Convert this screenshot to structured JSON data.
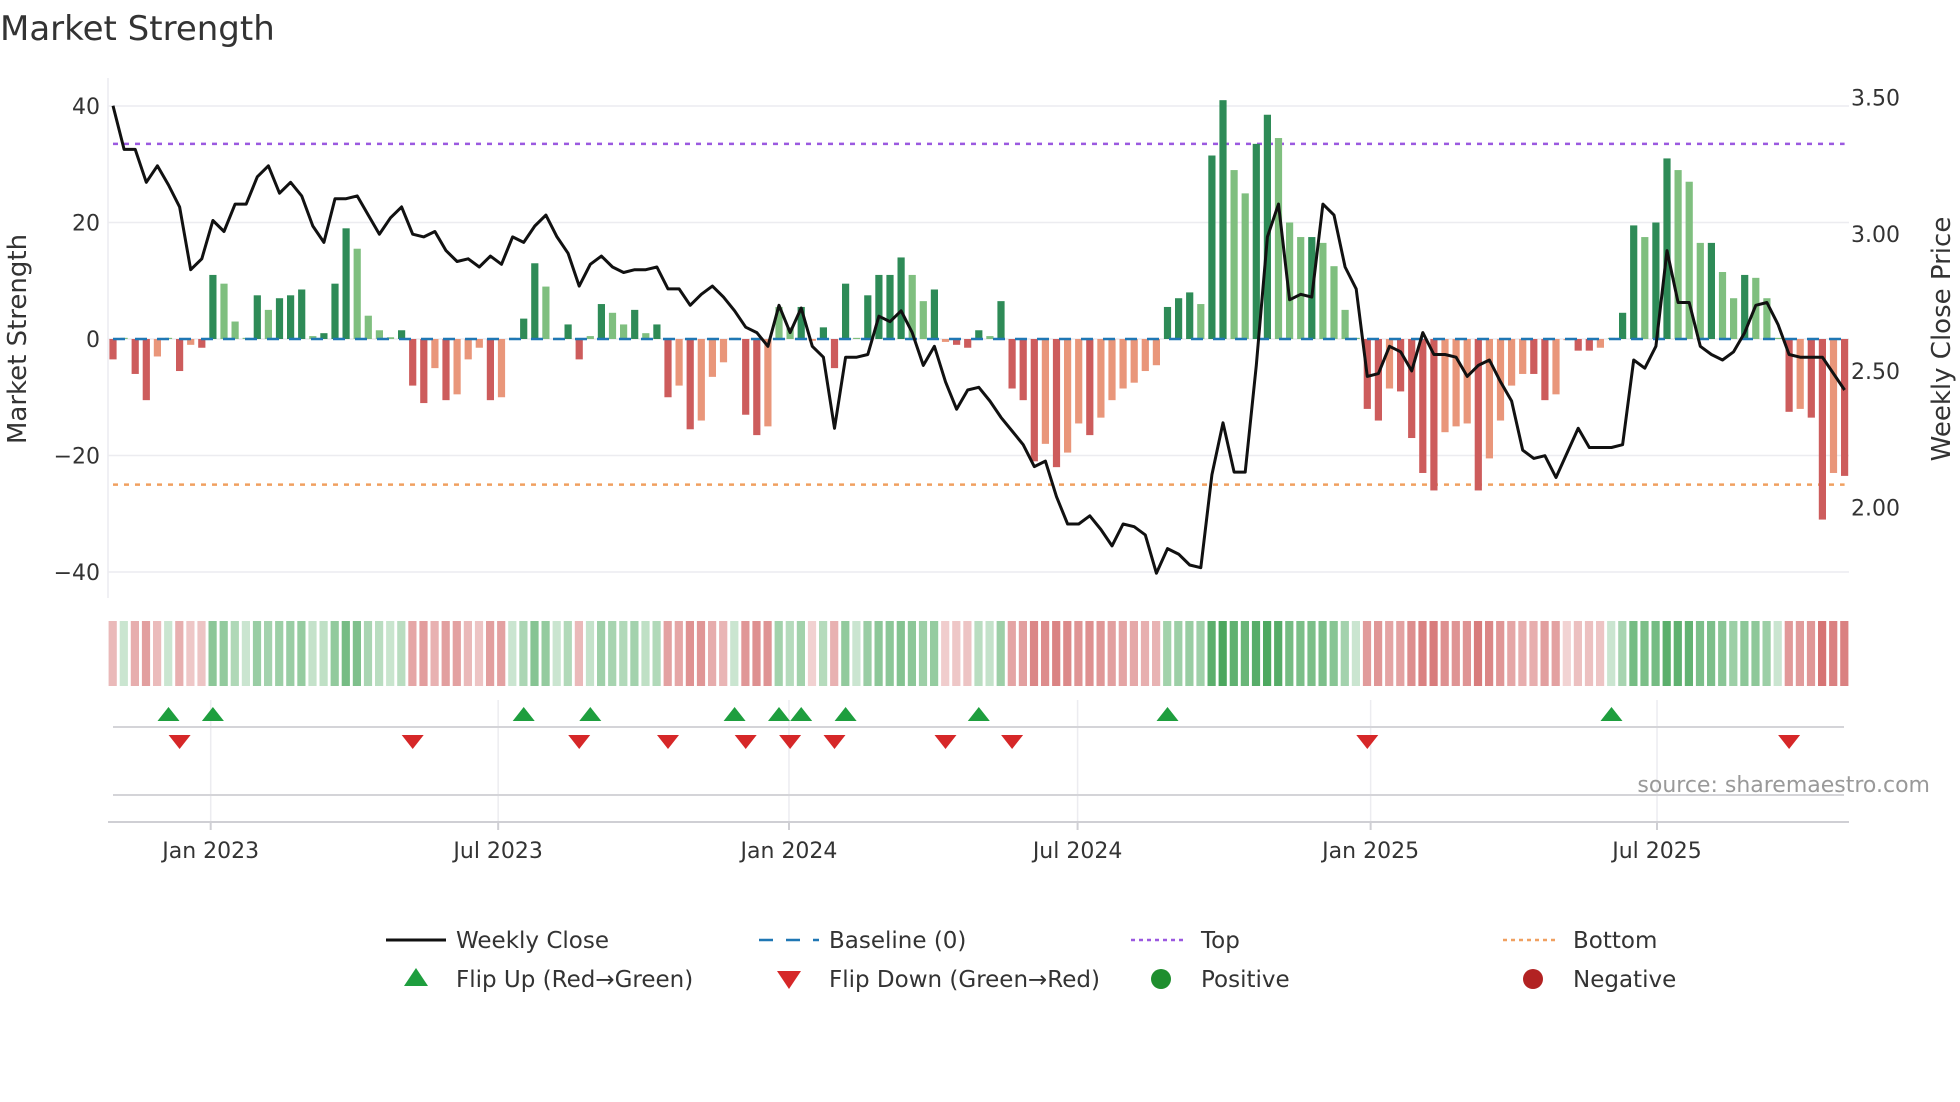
{
  "chart_data": {
    "type": "bar",
    "title": "Market Strength",
    "ylabel": "Market Strength",
    "y2label": "Weekly Close Price",
    "ylim": [
      -45,
      45
    ],
    "y2lim": [
      1.75,
      3.55
    ],
    "yticks": [
      40,
      20,
      0,
      -20,
      -40
    ],
    "ytick_labels": [
      "40",
      "20",
      "0",
      "−20",
      "−40"
    ],
    "y2ticks": [
      3.5,
      3.0,
      2.5,
      2.0
    ],
    "y2tick_labels": [
      "3.50",
      "3.00",
      "2.50",
      "2.00"
    ],
    "start_date": "2022-11-04",
    "frequency": "weekly",
    "xticks": [
      {
        "label": "Jan 2023",
        "week": 8.8
      },
      {
        "label": "Jul 2023",
        "week": 34.7
      },
      {
        "label": "Jan 2024",
        "week": 60.9
      },
      {
        "label": "Jul 2024",
        "week": 86.9
      },
      {
        "label": "Jan 2025",
        "week": 113.3
      },
      {
        "label": "Jul 2025",
        "week": 139.1
      }
    ],
    "top_level": 33.5,
    "bottom_level": -25,
    "baseline": 0,
    "strength": [
      -3.5,
      0.2,
      -6,
      -10.5,
      -3,
      0.2,
      -5.5,
      -1,
      -1.5,
      11,
      9.5,
      3,
      0.2,
      7.5,
      5,
      7,
      7.5,
      8.5,
      0.5,
      1,
      9.5,
      19,
      15.5,
      4,
      1.5,
      0.3,
      1.5,
      -8,
      -11,
      -5,
      -10.5,
      -9.5,
      -3.5,
      -1.5,
      -10.5,
      -10,
      0.2,
      3.5,
      13,
      9,
      0.2,
      2.5,
      -3.5,
      0.5,
      6,
      4.5,
      2.5,
      5,
      1,
      2.5,
      -10,
      -8,
      -15.5,
      -14,
      -6.5,
      -4,
      0.2,
      -13,
      -16.5,
      -15,
      5.5,
      2,
      5.5,
      -0.3,
      2,
      -5,
      9.5,
      0.2,
      7.5,
      11,
      11,
      14,
      11,
      6.5,
      8.5,
      -0.5,
      -1,
      -1.5,
      1.5,
      0.5,
      6.5,
      -8.5,
      -10.5,
      -21,
      -18,
      -22,
      -19.5,
      -14.5,
      -16.5,
      -13.5,
      -10.5,
      -8.5,
      -7.5,
      -5.5,
      -4.5,
      5.5,
      7,
      8,
      6,
      31.5,
      41,
      29,
      25,
      33.5,
      38.5,
      34.5,
      20,
      17.5,
      17.5,
      16.5,
      12.5,
      5,
      0.2,
      -12,
      -14,
      -8.5,
      -9,
      -17,
      -23,
      -26,
      -16,
      -15,
      -14.5,
      -26,
      -20.5,
      -14,
      -8,
      -6,
      -6,
      -10.5,
      -9.5,
      -0.2,
      -2,
      -2,
      -1.5,
      0.2,
      4.5,
      19.5,
      17.5,
      20,
      31,
      29,
      27,
      16.5,
      16.5,
      11.5,
      7,
      11,
      10.5,
      7,
      0.2,
      -12.5,
      -12,
      -13.5,
      -31,
      -23,
      -23.5
    ],
    "weekly_close": [
      3.47,
      3.31,
      3.31,
      3.19,
      3.25,
      3.18,
      3.1,
      2.87,
      2.91,
      3.05,
      3.01,
      3.11,
      3.11,
      3.21,
      3.25,
      3.15,
      3.19,
      3.14,
      3.03,
      2.97,
      3.13,
      3.13,
      3.14,
      3.07,
      3.0,
      3.06,
      3.1,
      3.0,
      2.99,
      3.01,
      2.94,
      2.9,
      2.91,
      2.88,
      2.92,
      2.89,
      2.99,
      2.97,
      3.03,
      3.07,
      2.99,
      2.93,
      2.81,
      2.89,
      2.92,
      2.88,
      2.86,
      2.87,
      2.87,
      2.88,
      2.8,
      2.8,
      2.74,
      2.78,
      2.81,
      2.77,
      2.72,
      2.66,
      2.64,
      2.59,
      2.74,
      2.64,
      2.73,
      2.59,
      2.55,
      2.29,
      2.55,
      2.55,
      2.56,
      2.7,
      2.68,
      2.72,
      2.64,
      2.52,
      2.59,
      2.46,
      2.36,
      2.43,
      2.44,
      2.39,
      2.33,
      2.28,
      2.23,
      2.15,
      2.17,
      2.04,
      1.94,
      1.94,
      1.97,
      1.92,
      1.86,
      1.94,
      1.93,
      1.9,
      1.76,
      1.85,
      1.83,
      1.79,
      1.78,
      2.12,
      2.31,
      2.13,
      2.13,
      2.52,
      2.99,
      3.11,
      2.76,
      2.78,
      2.77,
      3.11,
      3.07,
      2.88,
      2.8,
      2.48,
      2.49,
      2.59,
      2.57,
      2.5,
      2.64,
      2.56,
      2.56,
      2.55,
      2.48,
      2.52,
      2.54,
      2.46,
      2.39,
      2.21,
      2.18,
      2.19,
      2.11,
      2.2,
      2.29,
      2.22,
      2.22,
      2.22,
      2.23,
      2.54,
      2.51,
      2.59,
      2.94,
      2.75,
      2.75,
      2.59,
      2.56,
      2.54,
      2.57,
      2.64,
      2.74,
      2.75,
      2.67,
      2.56,
      2.55,
      2.55,
      2.55,
      2.49,
      2.43
    ],
    "flip_up_weeks": [
      5,
      9,
      37,
      43,
      56,
      60,
      62,
      66,
      78,
      95,
      135
    ],
    "flip_down_weeks": [
      6,
      27,
      42,
      50,
      57,
      61,
      65,
      75,
      81,
      113,
      151
    ],
    "legend": {
      "placement": "bottom",
      "items": [
        {
          "label": "Weekly Close",
          "kind": "line",
          "color": "#111111"
        },
        {
          "label": "Baseline (0)",
          "kind": "dash",
          "color": "#1f77b4"
        },
        {
          "label": "Top",
          "kind": "dot",
          "color": "#9b59e0"
        },
        {
          "label": "Bottom",
          "kind": "dot",
          "color": "#f0a060"
        },
        {
          "label": "Flip Up (Red→Green)",
          "kind": "tri-up",
          "color": "#1e9e3e"
        },
        {
          "label": "Flip Down (Green→Red)",
          "kind": "tri-down",
          "color": "#d62728"
        },
        {
          "label": "Positive",
          "kind": "circle",
          "color": "#1e8e2e"
        },
        {
          "label": "Negative",
          "kind": "circle",
          "color": "#b22222"
        }
      ]
    },
    "colors": {
      "pos_strong": "#2e8b57",
      "pos_weak": "#7fbf7f",
      "neg_strong": "#cd5c5c",
      "neg_weak": "#e9967a",
      "top": "#9b59e0",
      "bottom": "#f0a060",
      "baseline": "#1f77b4"
    },
    "source": "source: sharemaestro.com"
  }
}
